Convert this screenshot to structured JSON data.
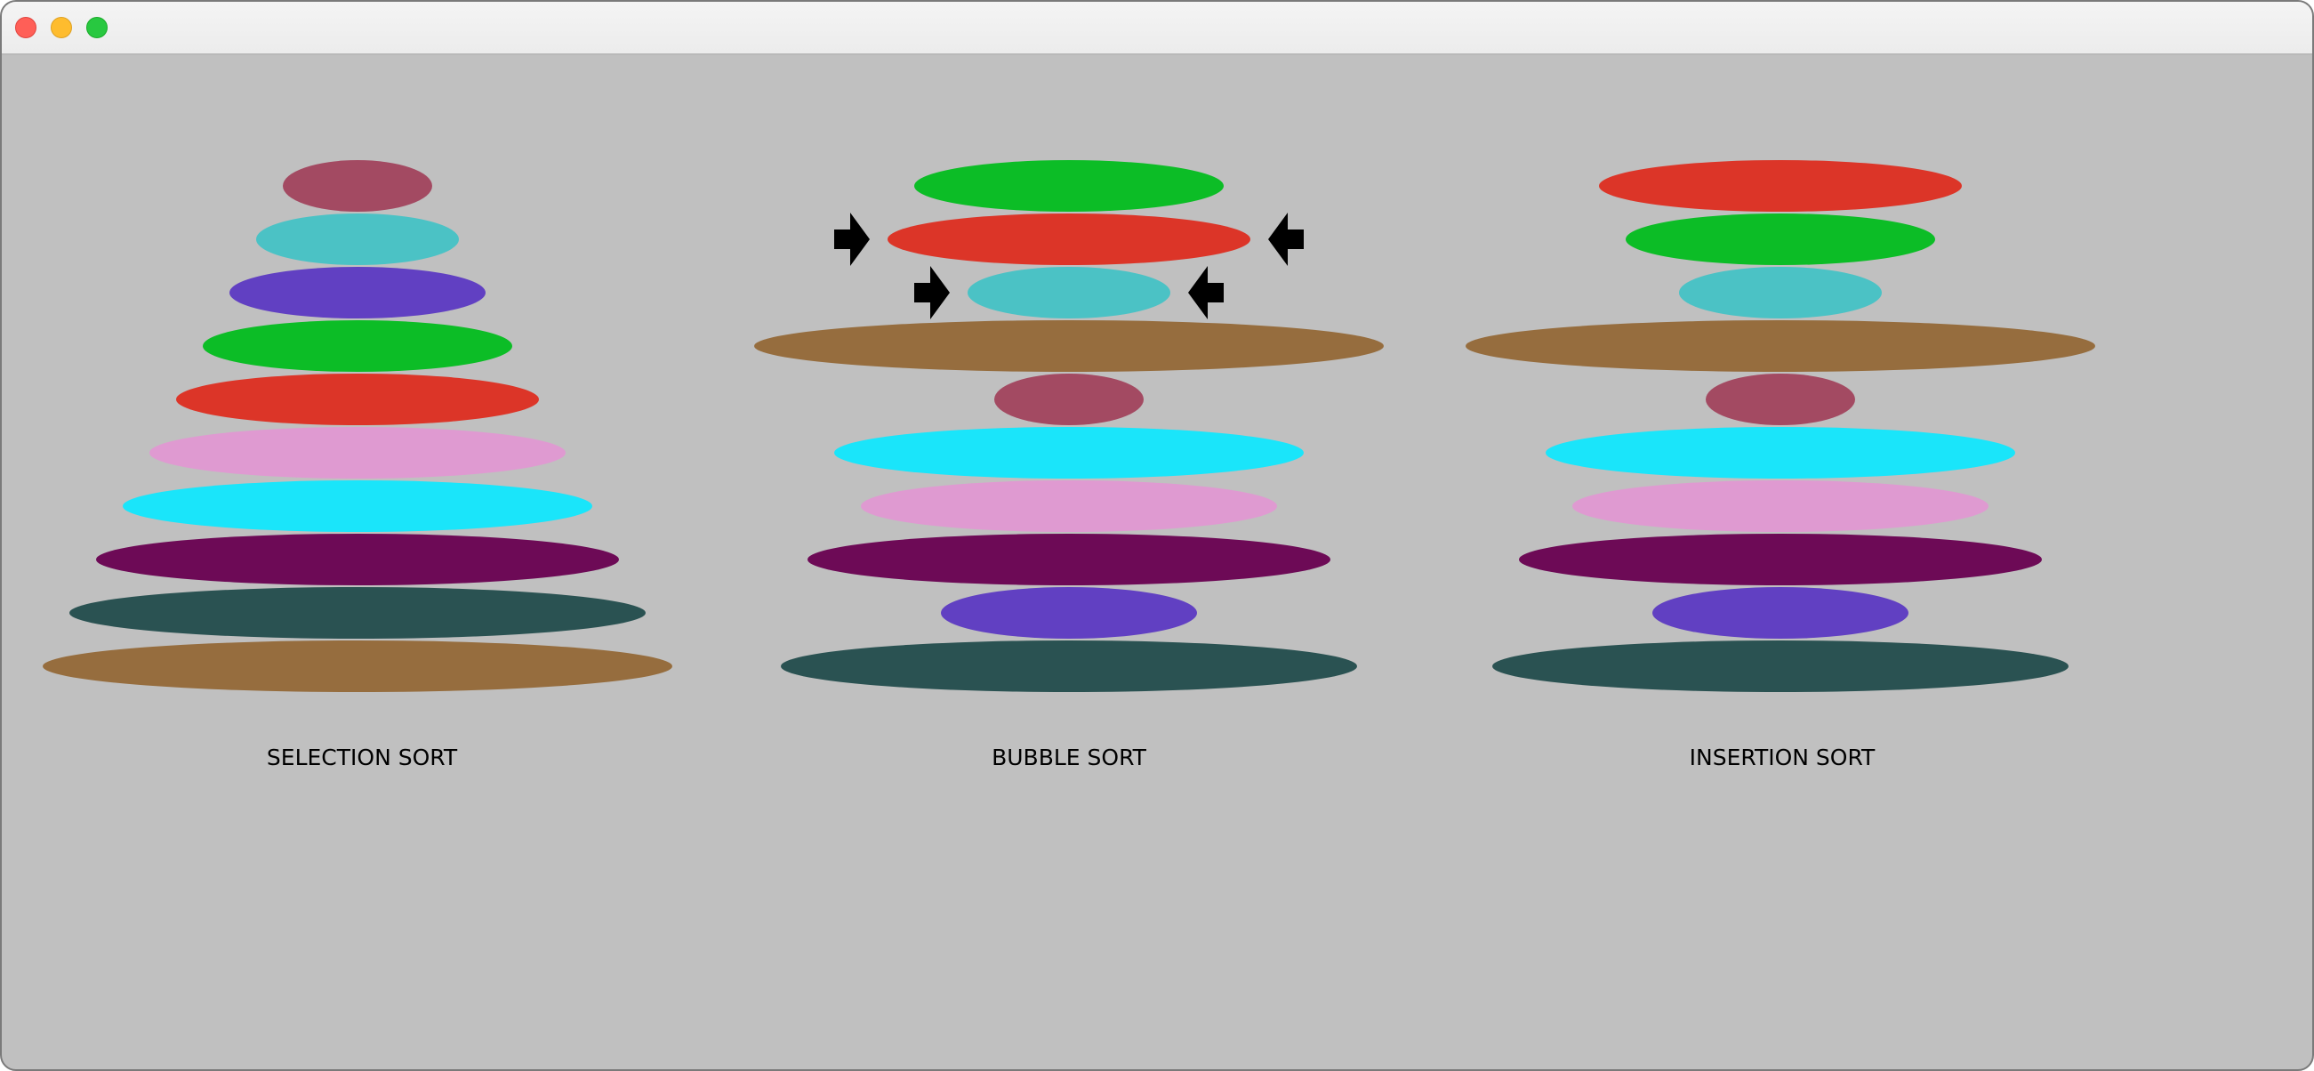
{
  "window": {
    "controls": [
      {
        "name": "close-button",
        "color": "#ff5f57"
      },
      {
        "name": "minimize-button",
        "color": "#febc2e"
      },
      {
        "name": "maximize-button",
        "color": "#28c840"
      }
    ],
    "background": "#c0c0c0"
  },
  "palette": {
    "maroon": "#a34a62",
    "teal": "#4bc2c5",
    "purple": "#6140c2",
    "green": "#0cbd26",
    "red": "#dc3528",
    "pink": "#df9ad1",
    "cyan": "#1ae5fa",
    "plum": "#6d0a56",
    "slate": "#2a5252",
    "brown": "#966d3e"
  },
  "columns": [
    {
      "label": "SELECTION SORT",
      "disks": [
        {
          "size": 2,
          "color": "maroon"
        },
        {
          "size": 3,
          "color": "teal"
        },
        {
          "size": 4,
          "color": "purple"
        },
        {
          "size": 5,
          "color": "green"
        },
        {
          "size": 6,
          "color": "red"
        },
        {
          "size": 7,
          "color": "pink"
        },
        {
          "size": 8,
          "color": "cyan"
        },
        {
          "size": 9,
          "color": "plum"
        },
        {
          "size": 10,
          "color": "slate"
        },
        {
          "size": 11,
          "color": "brown"
        }
      ],
      "markers": []
    },
    {
      "label": "BUBBLE SORT",
      "disks": [
        {
          "size": 5,
          "color": "green"
        },
        {
          "size": 6,
          "color": "red"
        },
        {
          "size": 3,
          "color": "teal"
        },
        {
          "size": 11,
          "color": "brown"
        },
        {
          "size": 2,
          "color": "maroon"
        },
        {
          "size": 8,
          "color": "cyan"
        },
        {
          "size": 7,
          "color": "pink"
        },
        {
          "size": 9,
          "color": "plum"
        },
        {
          "size": 4,
          "color": "purple"
        },
        {
          "size": 10,
          "color": "slate"
        }
      ],
      "markers": [
        1,
        2
      ]
    },
    {
      "label": "INSERTION SORT",
      "disks": [
        {
          "size": 6,
          "color": "red"
        },
        {
          "size": 5,
          "color": "green"
        },
        {
          "size": 3,
          "color": "teal"
        },
        {
          "size": 11,
          "color": "brown"
        },
        {
          "size": 2,
          "color": "maroon"
        },
        {
          "size": 8,
          "color": "cyan"
        },
        {
          "size": 7,
          "color": "pink"
        },
        {
          "size": 9,
          "color": "plum"
        },
        {
          "size": 4,
          "color": "purple"
        },
        {
          "size": 10,
          "color": "slate"
        }
      ],
      "markers": []
    }
  ]
}
